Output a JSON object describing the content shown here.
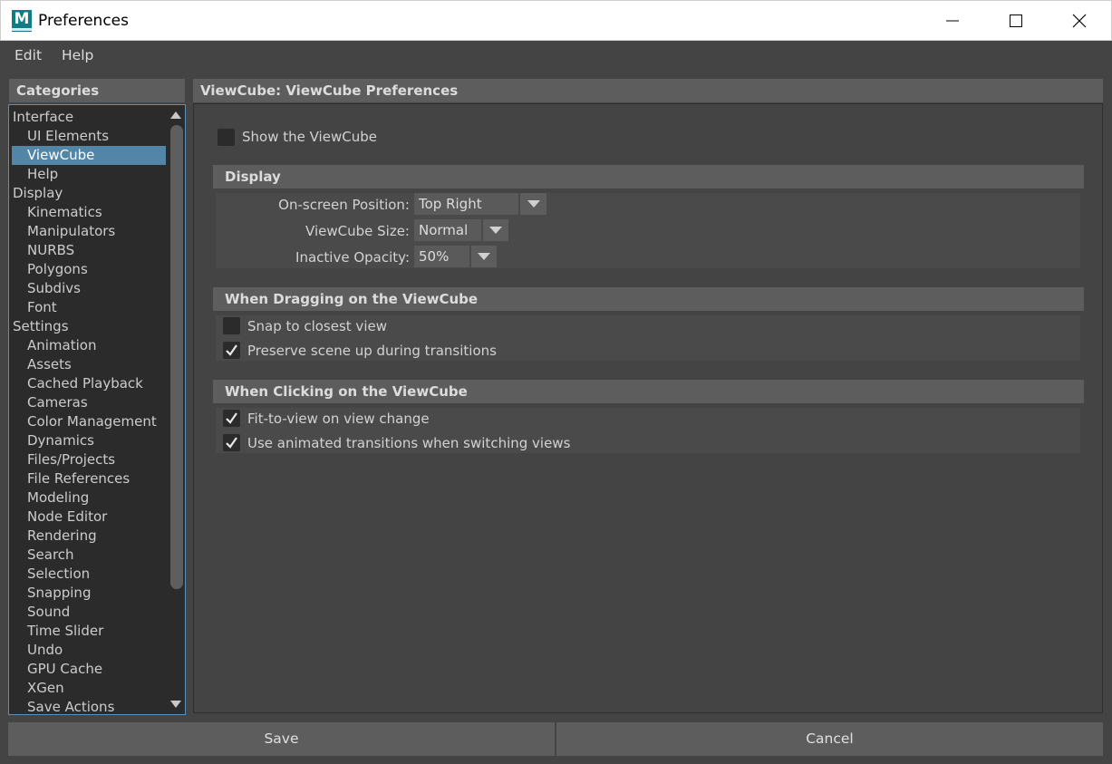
{
  "window": {
    "title": "Preferences",
    "app_icon_letter": "M",
    "minimize_icon": "minimize-icon",
    "maximize_icon": "maximize-icon",
    "close_icon": "close-icon"
  },
  "menu": {
    "edit": "Edit",
    "help": "Help"
  },
  "categories": {
    "header": "Categories",
    "items": [
      {
        "label": "Interface",
        "level": "top"
      },
      {
        "label": "UI Elements",
        "level": "sub"
      },
      {
        "label": "ViewCube",
        "level": "sub",
        "selected": true
      },
      {
        "label": "Help",
        "level": "sub"
      },
      {
        "label": "Display",
        "level": "top"
      },
      {
        "label": "Kinematics",
        "level": "sub"
      },
      {
        "label": "Manipulators",
        "level": "sub"
      },
      {
        "label": "NURBS",
        "level": "sub"
      },
      {
        "label": "Polygons",
        "level": "sub"
      },
      {
        "label": "Subdivs",
        "level": "sub"
      },
      {
        "label": "Font",
        "level": "sub"
      },
      {
        "label": "Settings",
        "level": "top"
      },
      {
        "label": "Animation",
        "level": "sub"
      },
      {
        "label": "Assets",
        "level": "sub"
      },
      {
        "label": "Cached Playback",
        "level": "sub"
      },
      {
        "label": "Cameras",
        "level": "sub"
      },
      {
        "label": "Color Management",
        "level": "sub"
      },
      {
        "label": "Dynamics",
        "level": "sub"
      },
      {
        "label": "Files/Projects",
        "level": "sub"
      },
      {
        "label": "File References",
        "level": "sub"
      },
      {
        "label": "Modeling",
        "level": "sub"
      },
      {
        "label": "Node Editor",
        "level": "sub"
      },
      {
        "label": "Rendering",
        "level": "sub"
      },
      {
        "label": "Search",
        "level": "sub"
      },
      {
        "label": "Selection",
        "level": "sub"
      },
      {
        "label": "Snapping",
        "level": "sub"
      },
      {
        "label": "Sound",
        "level": "sub"
      },
      {
        "label": "Time Slider",
        "level": "sub"
      },
      {
        "label": "Undo",
        "level": "sub"
      },
      {
        "label": "GPU Cache",
        "level": "sub"
      },
      {
        "label": "XGen",
        "level": "sub"
      },
      {
        "label": "Save Actions",
        "level": "sub"
      }
    ]
  },
  "pane": {
    "header": "ViewCube: ViewCube Preferences",
    "show_viewcube": {
      "label": "Show the ViewCube",
      "checked": false
    },
    "display": {
      "title": "Display",
      "onscreen_position": {
        "label": "On-screen Position:",
        "value": "Top Right"
      },
      "viewcube_size": {
        "label": "ViewCube Size:",
        "value": "Normal"
      },
      "inactive_opacity": {
        "label": "Inactive Opacity:",
        "value": "50%"
      }
    },
    "dragging": {
      "title": "When Dragging on the ViewCube",
      "snap": {
        "label": "Snap to closest view",
        "checked": false
      },
      "preserve": {
        "label": "Preserve scene up during transitions",
        "checked": true
      }
    },
    "clicking": {
      "title": "When Clicking on the ViewCube",
      "fit": {
        "label": "Fit-to-view on view change",
        "checked": true
      },
      "animated": {
        "label": "Use animated transitions when switching views",
        "checked": true
      }
    }
  },
  "buttons": {
    "save": "Save",
    "cancel": "Cancel"
  }
}
